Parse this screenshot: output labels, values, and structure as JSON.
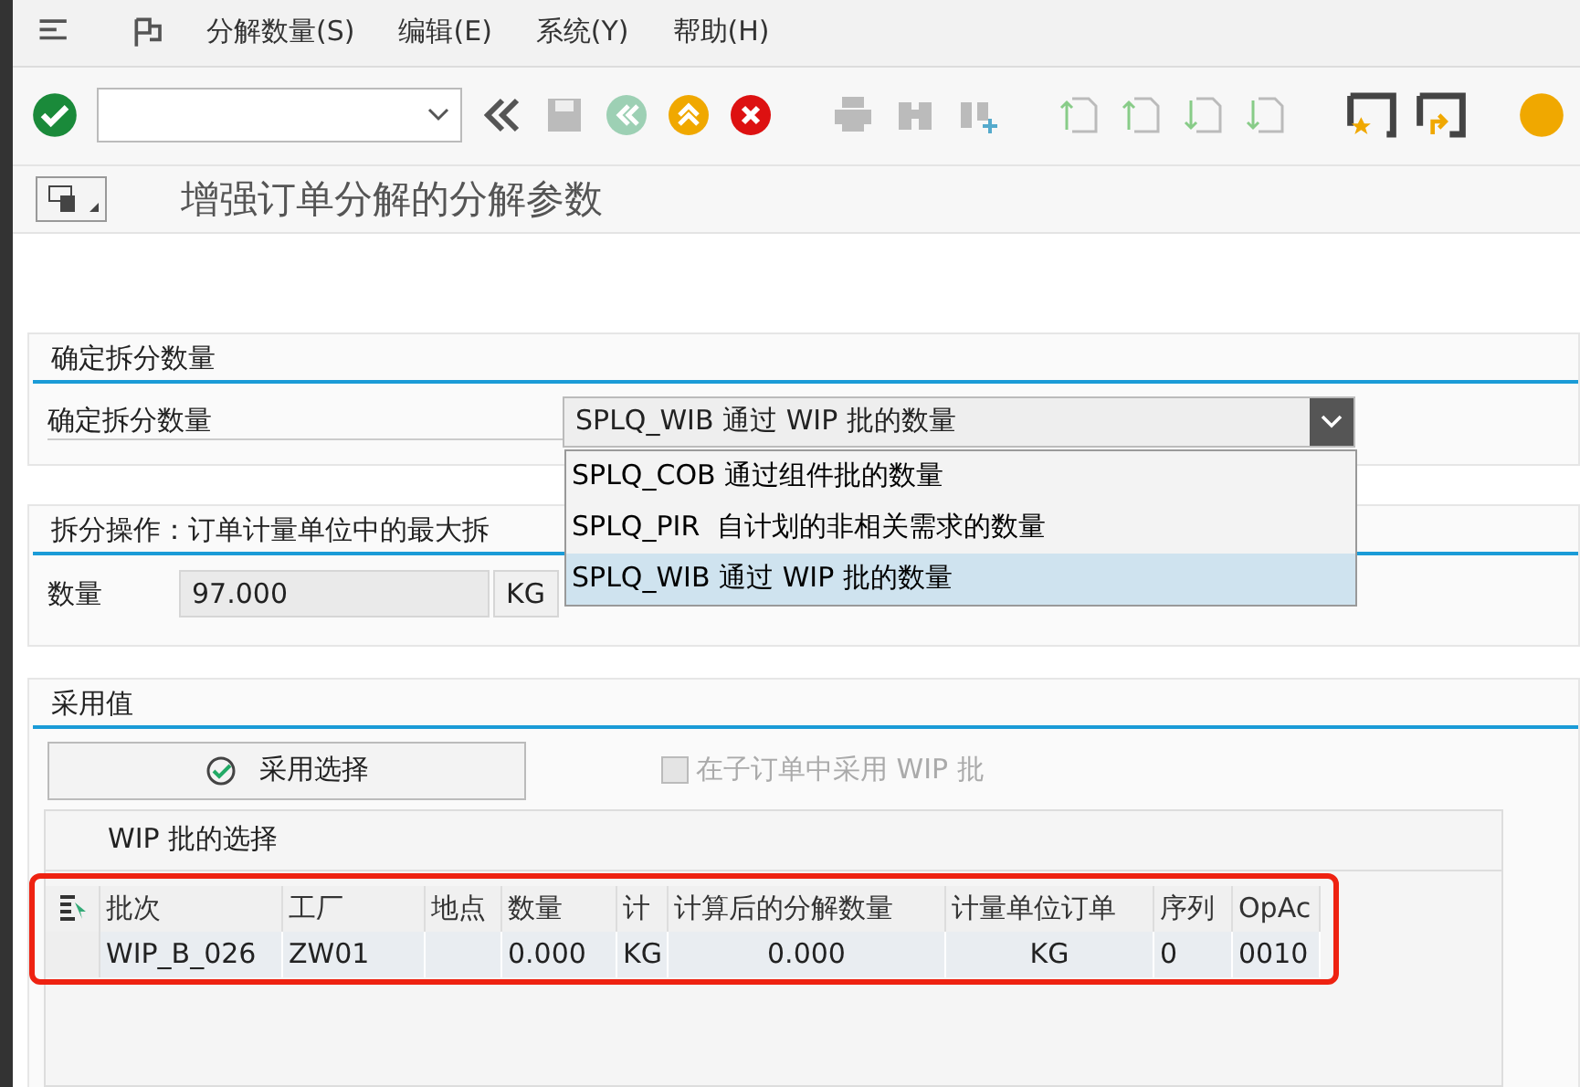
{
  "menu": [
    {
      "label": "分解数量(S)"
    },
    {
      "label": "编辑(E)"
    },
    {
      "label": "系统(Y)"
    },
    {
      "label": "帮助(H)"
    }
  ],
  "title": "增强订单分解的分解参数",
  "split_quantity": {
    "title": "确定拆分数量",
    "label": "确定拆分数量",
    "dropdown": {
      "value": "SPLQ_WIB 通过 WIP 批的数量",
      "expanded": true,
      "options": [
        {
          "label": "SPLQ_COB 通过组件批的数量",
          "selected": false
        },
        {
          "label": "SPLQ_PIR  自计划的非相关需求的数量",
          "selected": false
        },
        {
          "label": "SPLQ_WIB 通过 WIP 批的数量",
          "selected": true
        }
      ]
    }
  },
  "split_operation": {
    "title": "拆分操作：订单计量单位中的最大拆",
    "label": "数量",
    "value": "97.000",
    "unit": "KG"
  },
  "adopt": {
    "title": "采用值",
    "button": "采用选择",
    "checkbox": {
      "label": "在子订单中采用 WIP 批",
      "checked": false,
      "disabled": true
    },
    "table": {
      "title": "WIP 批的选择",
      "highlighted": true,
      "columns": [
        {
          "label": "批次"
        },
        {
          "label": "工厂"
        },
        {
          "label": "地点"
        },
        {
          "label": "数量"
        },
        {
          "label": "计"
        },
        {
          "label": "计算后的分解数量"
        },
        {
          "label": "计量单位订单"
        },
        {
          "label": "序列"
        },
        {
          "label": "OpAc"
        }
      ],
      "rows": [
        [
          "WIP_B_026",
          "ZW01",
          "",
          "0.000",
          "KG",
          "0.000",
          "KG",
          "0",
          "0010"
        ]
      ]
    }
  }
}
